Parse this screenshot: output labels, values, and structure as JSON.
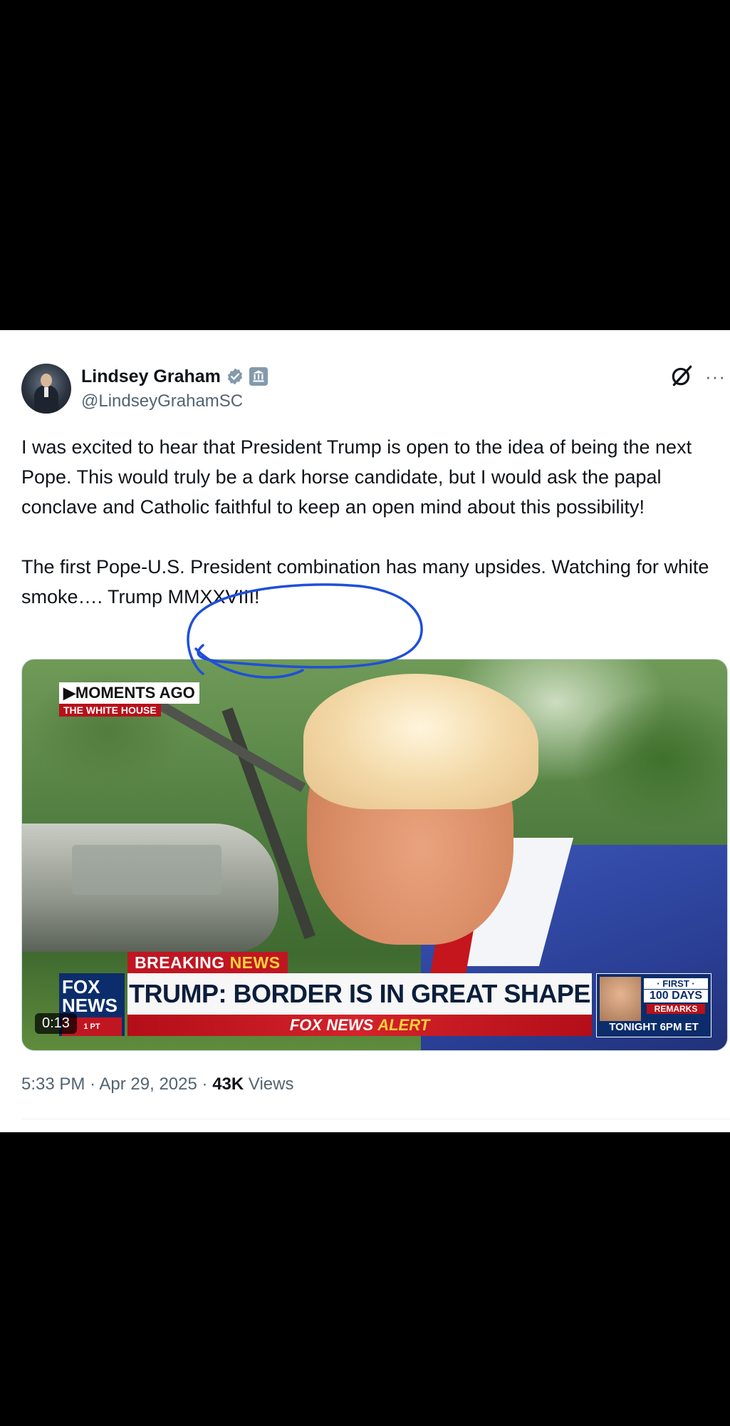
{
  "tweet": {
    "author_name": "Lindsey Graham",
    "handle": "@LindseyGrahamSC",
    "paragraphs": [
      "I was excited to hear that President Trump is open to the idea of being the next Pope. This would truly be a dark horse candidate, but I would ask the papal conclave and Catholic faithful to keep an open mind about this possibility!",
      "The first Pope-U.S. President combination has many upsides. Watching for white smoke…. Trump MMXXVIII!"
    ],
    "more_label": "···",
    "icons": {
      "verified": "verified-badge-icon",
      "gov": "government-badge-icon",
      "grok": "grok-icon"
    }
  },
  "video": {
    "moments_label": "▶MOMENTS AGO",
    "location_label": "THE WHITE HOUSE",
    "breaking_label": "BREAKING",
    "breaking_label_accent": "NEWS",
    "headline": "TRUMP: BORDER IS IN GREAT SHAPE",
    "alert_prefix": "FOX NEWS",
    "alert_accent": "ALERT",
    "logo_line1": "FOX",
    "logo_line2": "NEWS",
    "logo_sub": "1 PT",
    "promo_first": "· FIRST ·",
    "promo_days": "100 DAYS",
    "promo_remarks": "REMARKS",
    "promo_time": "TONIGHT 6PM ET",
    "duration": "0:13"
  },
  "meta": {
    "time": "5:33 PM",
    "sep1": "·",
    "date": "Apr 29, 2025",
    "sep2": "·",
    "views_count": "43K",
    "views_label": "Views"
  },
  "colors": {
    "background": "#000000",
    "card": "#ffffff",
    "text_primary": "#0f1419",
    "text_secondary": "#536471",
    "verified_blue": "#829aab",
    "scribble_blue": "#1f4fd8",
    "fox_red": "#c01622",
    "fox_navy": "#0c2d6b"
  }
}
